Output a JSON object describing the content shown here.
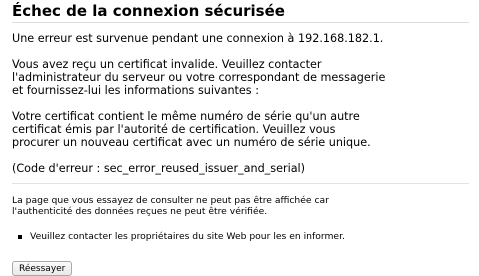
{
  "error": {
    "title": "Échec de la connexion sécurisée",
    "intro": "Une erreur est survenue pendant une connexion à 192.168.182.1.",
    "para2": [
      "Vous avez reçu un certificat invalide. Veuillez contacter",
      "l'administrateur du serveur ou votre correspondant de messagerie",
      "et fournissez-lui les informations suivantes :"
    ],
    "para3": [
      "Votre certificat contient le même numéro de série qu'un autre",
      "certificat émis par l'autorité de certification. Veuillez vous",
      "procurer un nouveau certificat avec un numéro de série unique."
    ],
    "code": "(Code d'erreur : sec_error_reused_issuer_and_serial)"
  },
  "short": {
    "lines": [
      "La page que vous essayez de consulter ne peut pas être affichée car",
      "l'authenticité des données reçues ne peut être vérifiée."
    ],
    "advice": "Veuillez contacter les propriétaires du site Web pour les en informer."
  },
  "actions": {
    "retry_label": "Réessayer"
  }
}
